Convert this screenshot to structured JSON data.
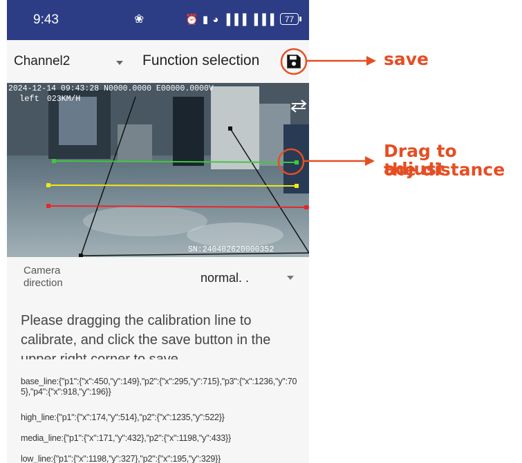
{
  "status_bar": {
    "time": "9:43",
    "activity_glyph": "❀",
    "icons_text": "⏰ ▮ ◕ ▐▐▐ ▐▐▐",
    "battery": "77"
  },
  "toolbar": {
    "channel": "Channel2",
    "function_title": "Function selection"
  },
  "video": {
    "osd_timestamp": "2024-12-14 09:43:28 N0000.0000 E00000.0000V",
    "osd_direction": "left",
    "osd_speed": "023KM/H",
    "osd_serial": "SN:240402620000352"
  },
  "camera_direction": {
    "label": "Camera direction",
    "value": "normal. ."
  },
  "instruction": "Please dragging the calibration line to calibrate, and click the save button in the upper right corner to save",
  "coordinates": {
    "base_line": "base_line:{\"p1\":{\"x\":450,\"y\":149},\"p2\":{\"x\":295,\"y\":715},\"p3\":{\"x\":1236,\"y\":705},\"p4\":{\"x\":918,\"y\":196}}",
    "high_line": "high_line:{\"p1\":{\"x\":174,\"y\":514},\"p2\":{\"x\":1235,\"y\":522}}",
    "media_line": "media_line:{\"p1\":{\"x\":171,\"y\":432},\"p2\":{\"x\":1198,\"y\":433}}",
    "low_line": "low_line:{\"p1\":{\"x\":1198,\"y\":327},\"p2\":{\"x\":195,\"y\":329}}"
  },
  "annotations": {
    "save": "save",
    "drag_line1": "Drag to adjust",
    "drag_line2": "the distance"
  },
  "colors": {
    "status_bar": "#2c3d86",
    "annotation": "#e54e24",
    "line_green": "#3ec93a",
    "line_yellow": "#f2ea12",
    "line_red": "#e8262a"
  }
}
